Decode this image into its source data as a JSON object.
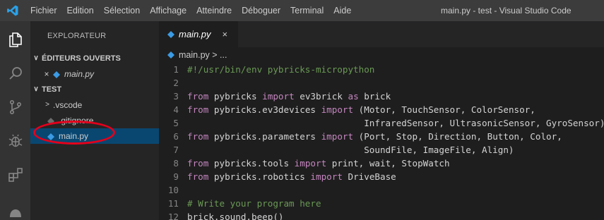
{
  "titlebar": {
    "logo": "vscode-logo",
    "menu": [
      "Fichier",
      "Edition",
      "Sélection",
      "Affichage",
      "Atteindre",
      "Déboguer",
      "Terminal",
      "Aide"
    ],
    "window_title": "main.py - test - Visual Studio Code"
  },
  "activitybar": {
    "icons": [
      "explorer-icon",
      "search-icon",
      "source-control-icon",
      "debug-icon",
      "extensions-icon",
      "remote-icon"
    ]
  },
  "sidebar": {
    "title": "EXPLORATEUR",
    "open_editors_header": "ÉDITEURS OUVERTS",
    "open_editor_file": "main.py",
    "folder_header": "TEST",
    "items": [
      {
        "label": ".vscode",
        "kind": "folder"
      },
      {
        "label": ".gitignore",
        "kind": "file"
      },
      {
        "label": "main.py",
        "kind": "python",
        "selected": true
      }
    ]
  },
  "editor": {
    "tab_label": "main.py",
    "tab_close": "×",
    "breadcrumb": "main.py > ...",
    "lines": [
      {
        "n": "1",
        "text": "#!/usr/bin/env pybricks-micropython"
      },
      {
        "n": "2",
        "text": ""
      },
      {
        "n": "3",
        "text": "from pybricks import ev3brick as brick"
      },
      {
        "n": "4",
        "text": "from pybricks.ev3devices import (Motor, TouchSensor, ColorSensor,"
      },
      {
        "n": "5",
        "text": "                                 InfraredSensor, UltrasonicSensor, GyroSensor)"
      },
      {
        "n": "6",
        "text": "from pybricks.parameters import (Port, Stop, Direction, Button, Color,"
      },
      {
        "n": "7",
        "text": "                                 SoundFile, ImageFile, Align)"
      },
      {
        "n": "8",
        "text": "from pybricks.tools import print, wait, StopWatch"
      },
      {
        "n": "9",
        "text": "from pybricks.robotics import DriveBase"
      },
      {
        "n": "10",
        "text": ""
      },
      {
        "n": "11",
        "text": "# Write your program here"
      },
      {
        "n": "12",
        "text": "brick.sound.beep()"
      }
    ]
  },
  "colors": {
    "keyword": "#c586c0",
    "comment": "#6a9955",
    "text": "#d4d4d4",
    "selection": "#094771",
    "highlight_ellipse": "#e3001b"
  }
}
